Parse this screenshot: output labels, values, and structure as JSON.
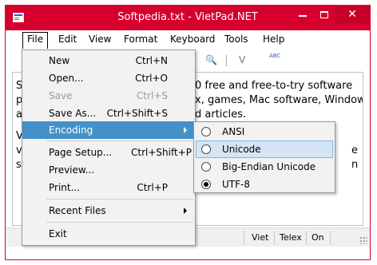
{
  "window": {
    "title": "Softpedia.txt - VietPad.NET",
    "close_glyph": "✕"
  },
  "menubar": [
    "File",
    "Edit",
    "View",
    "Format",
    "Keyboard",
    "Tools",
    "Help"
  ],
  "toolbar": {
    "find_glyph": "🔍",
    "keyboard_glyph": "V",
    "spell_glyph": "ABC"
  },
  "editor": {
    "lines": [
      "0 free and free-to-try software",
      "x, games, Mac software, Windows",
      "d articles."
    ],
    "fragments": [
      "S",
      "p",
      "a",
      "V",
      "v",
      "s",
      "e",
      "n"
    ]
  },
  "file_menu": {
    "items": [
      {
        "label": "New",
        "shortcut": "Ctrl+N",
        "enabled": true
      },
      {
        "label": "Open...",
        "shortcut": "Ctrl+O",
        "enabled": true
      },
      {
        "label": "Save",
        "shortcut": "Ctrl+S",
        "enabled": false
      },
      {
        "label": "Save As...",
        "shortcut": "Ctrl+Shift+S",
        "enabled": true
      },
      {
        "label": "Encoding",
        "shortcut": "",
        "enabled": true,
        "submenu": true,
        "highlighted": true
      },
      {
        "label": "Page Setup...",
        "shortcut": "Ctrl+Shift+P",
        "enabled": true
      },
      {
        "label": "Preview...",
        "shortcut": "",
        "enabled": true
      },
      {
        "label": "Print...",
        "shortcut": "Ctrl+P",
        "enabled": true
      },
      {
        "label": "Recent Files",
        "shortcut": "",
        "enabled": true,
        "submenu": true
      },
      {
        "label": "Exit",
        "shortcut": "",
        "enabled": true
      }
    ]
  },
  "encoding_submenu": {
    "items": [
      {
        "label": "ANSI",
        "checked": false
      },
      {
        "label": "Unicode",
        "checked": false,
        "highlighted": true
      },
      {
        "label": "Big-Endian Unicode",
        "checked": false
      },
      {
        "label": "UTF-8",
        "checked": true
      }
    ]
  },
  "statusbar": {
    "mode": "Viet",
    "input": "Telex",
    "state": "On"
  },
  "colors": {
    "titlebar": "#d6002e",
    "menu_highlight": "#4391c8",
    "submenu_highlight": "#d5e5f5"
  }
}
